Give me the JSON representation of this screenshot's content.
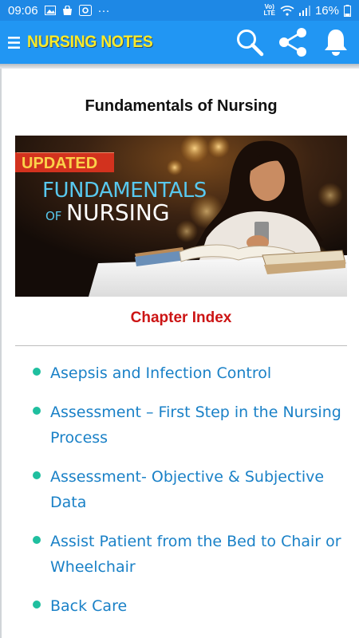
{
  "status_bar": {
    "time": "09:06",
    "more": "···",
    "network": "LTE",
    "battery": "16%"
  },
  "app_bar": {
    "title": "NURSING NOTES"
  },
  "page": {
    "title": "Fundamentals of Nursing",
    "banner": {
      "badge": "UPDATED",
      "line1": "FUNDAMENTALS",
      "line2_small": "OF",
      "line2": "NURSING"
    },
    "chapter_index_label": "Chapter Index",
    "chapters": [
      "Asepsis and Infection Control",
      "Assessment – First Step in the Nursing Process",
      "Assessment- Objective & Subjective Data",
      "Assist Patient from the Bed to Chair or Wheelchair",
      "Back Care"
    ]
  },
  "colors": {
    "status_bar": "#1e88e5",
    "app_bar": "#2196f3",
    "title_yellow": "#f8ea2a",
    "chapter_index_red": "#cc1414",
    "link_blue": "#1a81c7",
    "bullet_teal": "#1fbf9f"
  }
}
